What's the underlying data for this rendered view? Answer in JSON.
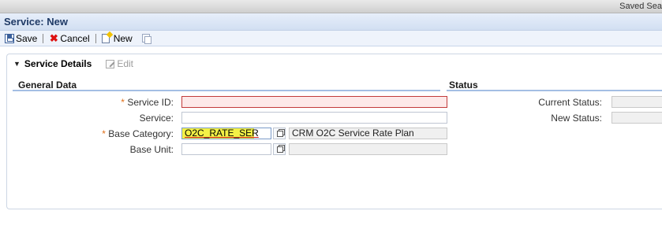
{
  "topbar": {
    "saved_searches": "Saved Sea"
  },
  "page": {
    "title": "Service: New"
  },
  "toolbar": {
    "save_label": "Save",
    "cancel_label": "Cancel",
    "new_label": "New"
  },
  "panel": {
    "title": "Service Details",
    "edit_label": "Edit"
  },
  "general_data": {
    "title": "General Data",
    "fields": {
      "service_id": {
        "label": "Service ID:",
        "required": "*",
        "value": ""
      },
      "service": {
        "label": "Service:",
        "value": ""
      },
      "base_category": {
        "label": "Base Category:",
        "required": "*",
        "value": "O2C_RATE_SER",
        "description": "CRM O2C Service Rate Plan"
      },
      "base_unit": {
        "label": "Base Unit:",
        "value": "",
        "description": ""
      }
    }
  },
  "status": {
    "title": "Status",
    "current_status_label": "Current Status:",
    "current_status_value": "",
    "new_status_label": "New Status:",
    "new_status_value": ""
  },
  "colors": {
    "title_text": "#1f3a66",
    "required_marker": "#e0701a",
    "error_field_bg": "#fde9e9",
    "highlight": "#f3f146",
    "section_underline": "#a4bee4"
  },
  "icons": [
    "save-icon",
    "cancel-icon",
    "new-document-icon",
    "copy-icon",
    "collapse-caret-icon",
    "edit-icon",
    "value-help-icon"
  ]
}
